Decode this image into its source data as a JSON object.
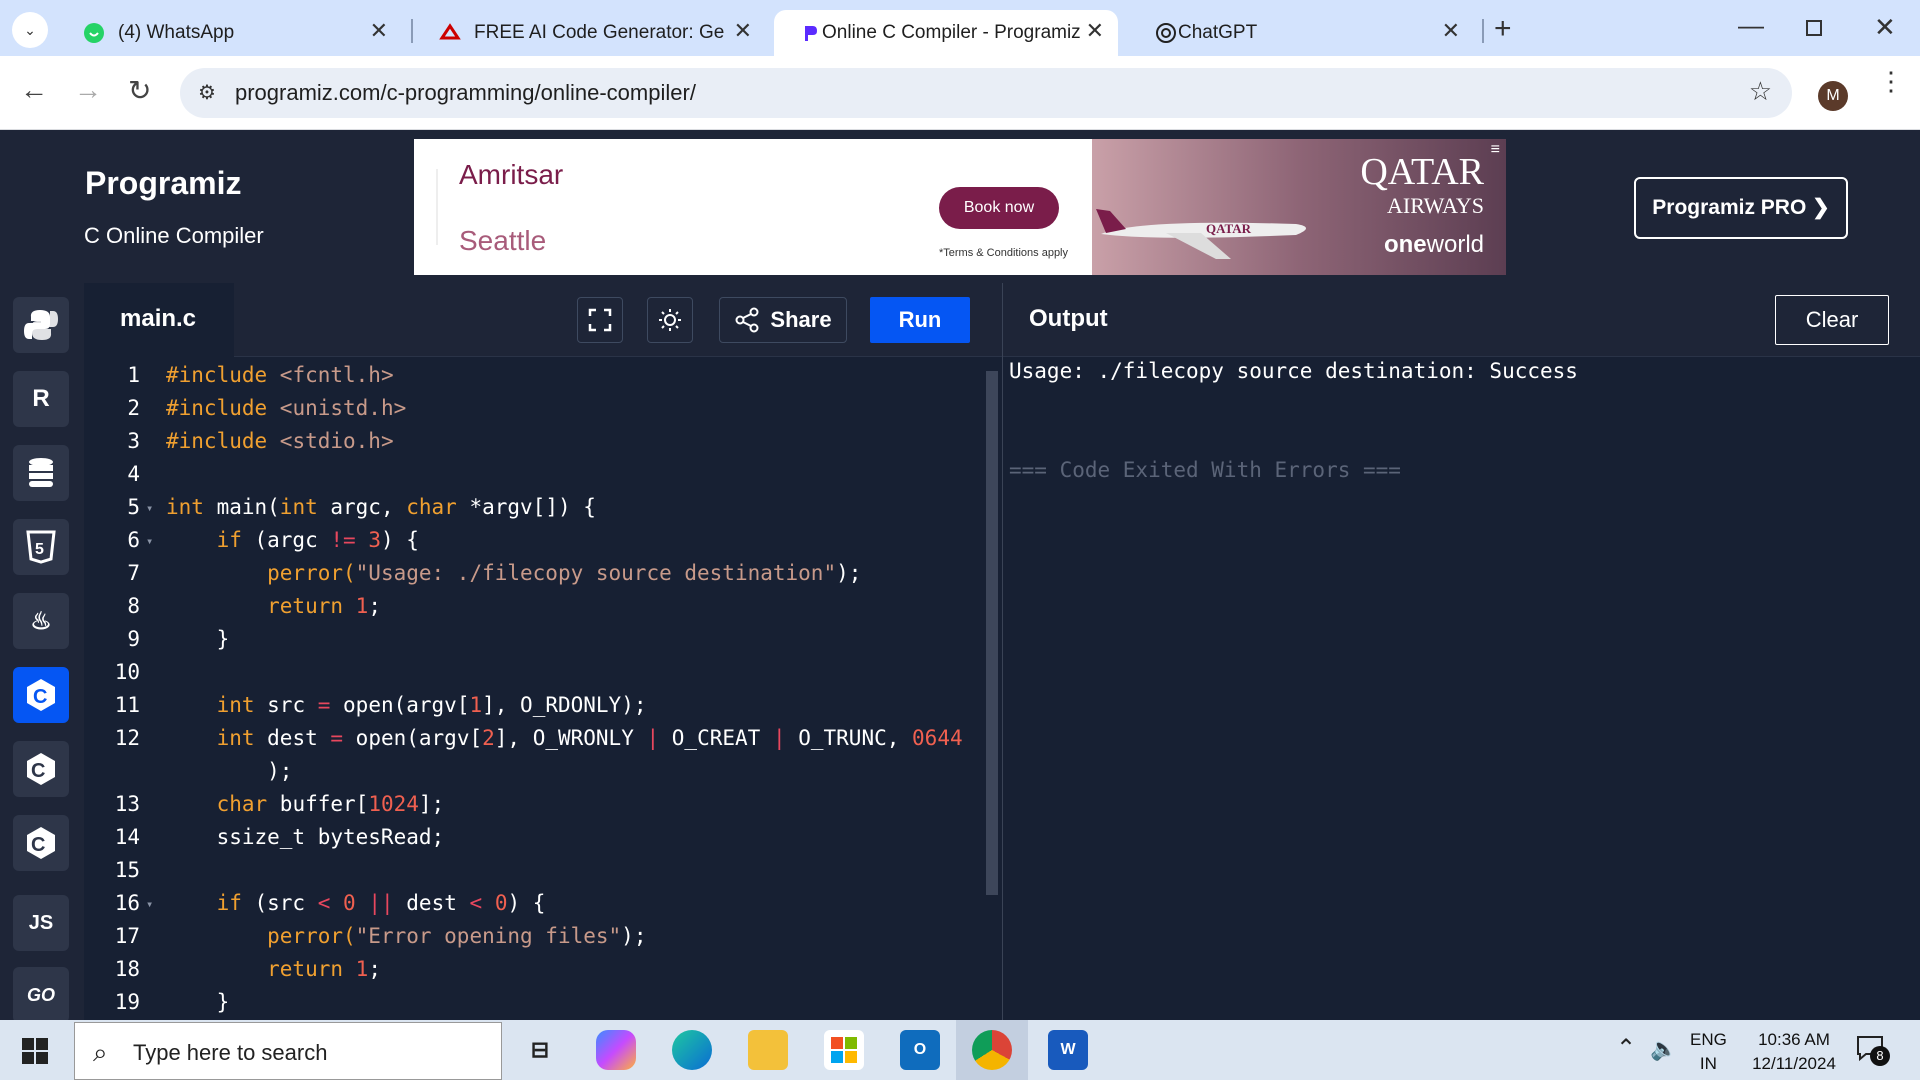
{
  "browser": {
    "tabs": [
      {
        "title": "(4) WhatsApp",
        "icon": "whatsapp-icon"
      },
      {
        "title": "FREE AI Code Generator: Gener",
        "icon": "ai-icon"
      },
      {
        "title": "Online C Compiler - Programiz",
        "icon": "programiz-icon",
        "active": true
      },
      {
        "title": "ChatGPT",
        "icon": "chatgpt-icon"
      }
    ],
    "url": "programiz.com/c-programming/online-compiler/",
    "avatar_letter": "M"
  },
  "site": {
    "logo": "Programiz",
    "subtitle": "C Online Compiler",
    "pro_label": "Programiz PRO ❯"
  },
  "ad": {
    "city_from": "Amritsar",
    "city_to": "Seattle",
    "cta": "Book now",
    "terms": "*Terms & Conditions apply",
    "brand_main": "QATAR",
    "brand_sub": "AIRWAYS",
    "alliance_bold": "one",
    "alliance_rest": "world",
    "plane_text": "QATAR"
  },
  "sidebar": {
    "items": [
      {
        "name": "python",
        "glyph": "🐍"
      },
      {
        "name": "r",
        "glyph": "R"
      },
      {
        "name": "sql",
        "glyph": "≡"
      },
      {
        "name": "html",
        "glyph": "5"
      },
      {
        "name": "java",
        "glyph": "♨"
      },
      {
        "name": "c",
        "glyph": "C",
        "active": true
      },
      {
        "name": "cpp",
        "glyph": "C"
      },
      {
        "name": "csharp",
        "glyph": "C"
      },
      {
        "name": "js",
        "glyph": "JS"
      },
      {
        "name": "go",
        "glyph": "GO"
      }
    ]
  },
  "editor": {
    "filename": "main.c",
    "share_label": "Share",
    "run_label": "Run",
    "lines": [
      {
        "no": "1"
      },
      {
        "no": "2"
      },
      {
        "no": "3"
      },
      {
        "no": "4"
      },
      {
        "no": "5"
      },
      {
        "no": "6"
      },
      {
        "no": "7"
      },
      {
        "no": "8"
      },
      {
        "no": "9"
      },
      {
        "no": "10"
      },
      {
        "no": "11"
      },
      {
        "no": "12"
      },
      {
        "no": "13"
      },
      {
        "no": "14"
      },
      {
        "no": "15"
      },
      {
        "no": "16"
      },
      {
        "no": "17"
      },
      {
        "no": "18"
      },
      {
        "no": "19"
      }
    ],
    "code": {
      "l1": [
        "#include ",
        "<fcntl.h>"
      ],
      "l2": [
        "#include ",
        "<unistd.h>"
      ],
      "l3": [
        "#include ",
        "<stdio.h>"
      ],
      "l5": [
        "int",
        " main(",
        "int",
        " argc, ",
        "char",
        " *argv[]) {"
      ],
      "l6": [
        "    if",
        " (argc ",
        "!=",
        " ",
        "3",
        ") {"
      ],
      "l7": [
        "        perror(",
        "\"Usage: ./filecopy source destination\"",
        ");"
      ],
      "l8": [
        "        return",
        " ",
        "1",
        ";"
      ],
      "l9": "    }",
      "l11": [
        "    int",
        " src ",
        "=",
        " open(argv[",
        "1",
        "], O_RDONLY);"
      ],
      "l12": [
        "    int",
        " dest ",
        "=",
        " open(argv[",
        "2",
        "], O_WRONLY ",
        "|",
        " O_CREAT ",
        "|",
        " O_TRUNC, ",
        "0644"
      ],
      "l12b": "        );",
      "l13": [
        "    char",
        " buffer[",
        "1024",
        "];"
      ],
      "l14": "    ssize_t bytesRead;",
      "l16": [
        "    if",
        " (src ",
        "<",
        " ",
        "0",
        " ",
        "||",
        " dest ",
        "<",
        " ",
        "0",
        ") {"
      ],
      "l17": [
        "        perror(",
        "\"Error opening files\"",
        ");"
      ],
      "l18": [
        "        return",
        " ",
        "1",
        ";"
      ],
      "l19": "    }"
    }
  },
  "output": {
    "title": "Output",
    "clear_label": "Clear",
    "line1": "Usage: ./filecopy source destination: Success",
    "line2": "=== Code Exited With Errors ==="
  },
  "taskbar": {
    "search_placeholder": "Type here to search",
    "lang": "ENG",
    "region": "IN",
    "time": "10:36 AM",
    "date": "12/11/2024",
    "notifications": "8"
  },
  "colors": {
    "accent": "#0556f3",
    "bg_dark": "#1e2537",
    "editor_bg": "#172033",
    "keyword": "#f0a030",
    "string": "#c89a8a",
    "number": "#f06050"
  }
}
